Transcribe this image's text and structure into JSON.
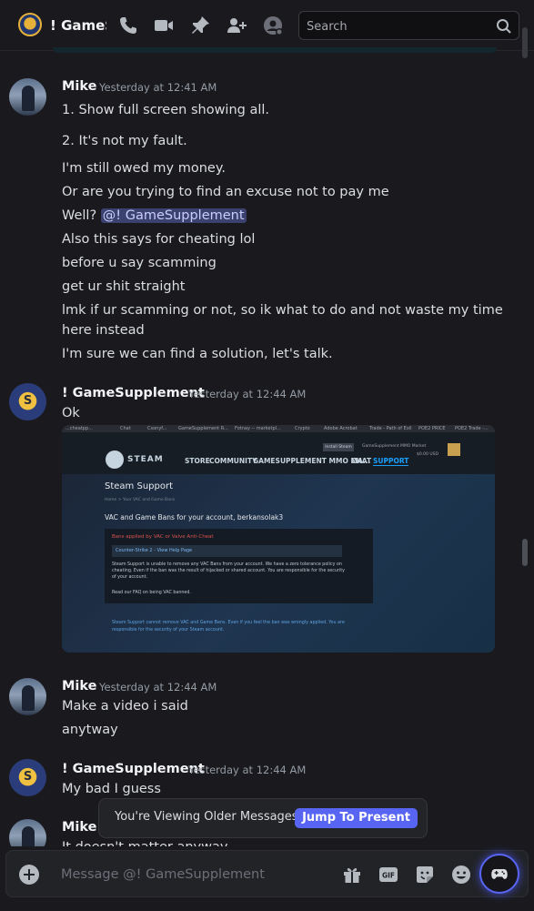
{
  "header": {
    "channel_name": "! GameSupplement",
    "search_placeholder": "Search"
  },
  "messages": [
    {
      "author": "Mike",
      "timestamp": "Yesterday at 12:41 AM",
      "lines": [
        "1. Show full screen showing all.",
        "2. It's not my fault.",
        "I'm still owed my money.",
        "Or are you trying to find an excuse not to pay me",
        "Well?",
        "Also this says for cheating lol",
        "before u say scamming",
        "get ur shit straight",
        "lmk if ur scamming or not, so ik what to do and not waste my time",
        "here instead",
        "I'm sure we can find a solution, let's talk."
      ],
      "mention": "@! GameSupplement"
    },
    {
      "author": "! GameSupplement",
      "timestamp": "Yesterday at 12:44 AM",
      "lines": [
        "Ok"
      ]
    },
    {
      "author": "Mike",
      "timestamp": "Yesterday at 12:44 AM",
      "lines": [
        "Make a video i said",
        "anytway"
      ]
    },
    {
      "author": "! GameSupplement",
      "timestamp": "Yesterday at 12:44 AM",
      "lines": [
        "My bad I guess"
      ]
    },
    {
      "author": "Mike",
      "timestamp": "",
      "lines": [
        "It doesn't matter anyway"
      ]
    }
  ],
  "attachment": {
    "bookmarks": [
      "...cheatpp...",
      "Chat",
      "Csonyf...",
      "GameSupplement R...",
      "Fotnay -- marketpl...",
      "Crypto",
      "Adobe Acrobat",
      "Trade - Path of Exil",
      "POE2 PRICE",
      "POE2 Trade -..."
    ],
    "brand": "STEAM",
    "nav": [
      "STORE",
      "COMMUNITY",
      "GAMESUPPLEMENT MMO MA...",
      "CHAT",
      "SUPPORT"
    ],
    "install": "Install Steam",
    "account": "GameSupplement MMO Market",
    "balance": "$0.00 USD",
    "title": "Steam Support",
    "breadcrumb": "Home > Your VAC and Game Bans",
    "subtitle": "VAC and Game Bans for your account, berkansolak3",
    "ban_header": "Bans applied by VAC or Valve Anti-Cheat",
    "game_row": "Counter-Strike 2 - View Help Page",
    "paragraph": "Steam Support is unable to remove any VAC Bans from your account. We have a zero tolerance policy on cheating. Even if the ban was the result of hijacked or shared account. You are responsible for the security of your account.",
    "faq": "Read our FAQ on being VAC banned.",
    "footer": "Steam Support cannot remove VAC and Game Bans. Even if you feel the ban was wrongly applied. You are responsible for the security of your Steam account."
  },
  "banner": {
    "text": "You're Viewing Older Messages",
    "button": "Jump To Present"
  },
  "composer": {
    "placeholder": "Message @! GameSupplement"
  },
  "colors": {
    "accent": "#5865f2",
    "mention_bg": "#3c4270",
    "mention_text": "#c9cdfb"
  },
  "icons": [
    "call-icon",
    "video-icon",
    "pin-icon",
    "add-friend-icon",
    "profile-icon",
    "search-icon",
    "add-icon",
    "gift-icon",
    "gif-icon",
    "sticker-icon",
    "emoji-icon",
    "activity-icon"
  ]
}
